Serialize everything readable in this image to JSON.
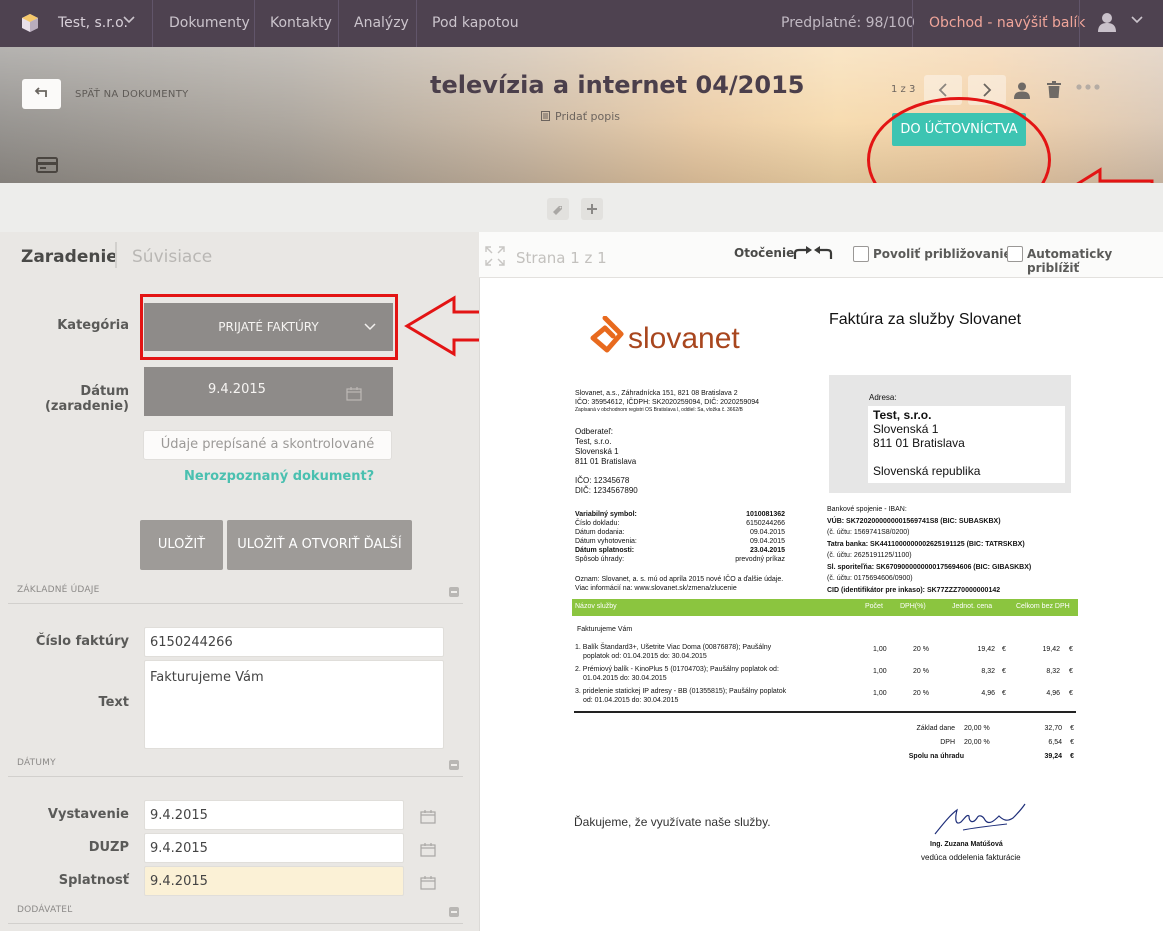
{
  "topnav": {
    "company": "Test, s.r.o.",
    "items": [
      "Dokumenty",
      "Kontakty",
      "Analýzy",
      "Pod kapotou"
    ],
    "subscription": "Predplatné: 98/100",
    "shop": "Obchod - navýšiť balík"
  },
  "header": {
    "back_label": "SPÄŤ NA DOKUMENTY",
    "title": "televízia a internet 04/2015",
    "add_description": "Pridať popis",
    "pager": "1 z 3",
    "accounting_button": "DO ÚČTOVNÍCTVA"
  },
  "left": {
    "tab_active": "Zaradenie",
    "tab_inactive": "Súvisiace",
    "category_label": "Kategória",
    "category_value": "PRIJATÉ FAKTÚRY",
    "date_label": "Dátum (zaradenie)",
    "date_value": "9.4.2015",
    "verified_button": "Údaje prepísané a skontrolované",
    "unrecognized_link": "Nerozpoznaný dokument?",
    "save_button": "ULOŽIŤ",
    "save_next_button": "ULOŽIŤ A OTVORIŤ ĎALŠÍ",
    "section_basic": "ZÁKLADNÉ ÚDAJE",
    "invoice_no_label": "Číslo faktúry",
    "invoice_no_value": "6150244266",
    "text_label": "Text",
    "text_value": "Fakturujeme Vám",
    "section_dates": "DÁTUMY",
    "issued_label": "Vystavenie",
    "issued_value": "9.4.2015",
    "duzp_label": "DUZP",
    "duzp_value": "9.4.2015",
    "due_label": "Splatnosť",
    "due_value": "9.4.2015",
    "section_supplier": "DODÁVATEĽ"
  },
  "viewer": {
    "page_info": "Strana 1 z 1",
    "rotation_label": "Otočenie",
    "allow_zoom": "Povoliť približovanie",
    "auto_zoom": "Automaticky priblížiť"
  },
  "invoice": {
    "logo": "slovanet",
    "title": "Faktúra za služby Slovanet",
    "supplier_lines": [
      "Slovanet, a.s., Záhradnícka 151, 821 08 Bratislava 2",
      "IČO: 35954612, IČDPH: SK2020259094, DIČ: 2020259094",
      "Zapísaná v obchodnom registri OS Bratislava I, oddiel: Sa, vložka č. 3662/B"
    ],
    "customer_lines": [
      "Odberateľ:",
      "Test, s.r.o.",
      "Slovenská 1",
      "811 01 Bratislava"
    ],
    "ids": [
      "IČO: 12345678",
      "DIČ: 1234567890"
    ],
    "address_label": "Adresa:",
    "address_lines": [
      "Test, s.r.o.",
      "Slovenská 1",
      "811 01 Bratislava",
      "",
      "Slovenská republika"
    ],
    "meta": [
      {
        "k": "Variabilný symbol:",
        "v": "1010081362"
      },
      {
        "k": "Číslo dokladu:",
        "v": "6150244266"
      },
      {
        "k": "Dátum dodania:",
        "v": "09.04.2015"
      },
      {
        "k": "Dátum vyhotovenia:",
        "v": "09.04.2015"
      },
      {
        "k": "Dátum splatnosti:",
        "v": "23.04.2015"
      },
      {
        "k": "Spôsob úhrady:",
        "v": "prevodný príkaz"
      }
    ],
    "bank_lines": [
      "Bankové spojenie - IBAN:",
      "VÚB: SK7202000000001569741S8 (BIC: SUBASKBX)",
      "(č. účtu: 1569741S8/0200)",
      "Tatra banka: SK4411000000002625191125 (BIC: TATRSKBX)",
      "(č. účtu: 2625191125/1100)",
      "Sl. sporiteľňa: SK6709000000000175694606 (BIC: GIBASKBX)",
      "(č. účtu: 0175694606/0900)",
      "CID (identifikátor pre inkaso): SK77ZZZ70000000142"
    ],
    "notice": [
      "Oznam: Slovanet, a. s. mú od apríla 2015 nové IČO a ďalšie údaje.",
      "Viac informácií na: www.slovanet.sk/zmena/zlucenie"
    ],
    "columns": [
      "Názov služby",
      "Počet",
      "DPH(%)",
      "Jednot. cena",
      "Celkom bez DPH"
    ],
    "intro": "Fakturujeme Vám",
    "items": [
      {
        "name1": "1. Balík Štandard3+, Ušetrite Viac Doma (00876878); Paušálny",
        "name2": "poplatok od: 01.04.2015 do: 30.04.2015",
        "qty": "1,00",
        "vat": "20 %",
        "unit": "19,42",
        "cur1": "€",
        "total": "19,42",
        "cur2": "€"
      },
      {
        "name1": "2. Prémiový balík - KinoPlus 5 (01704703); Paušálny poplatok od:",
        "name2": "01.04.2015 do: 30.04.2015",
        "qty": "1,00",
        "vat": "20 %",
        "unit": "8,32",
        "cur1": "€",
        "total": "8,32",
        "cur2": "€"
      },
      {
        "name1": "3. pridelenie statickej IP adresy - BB (01355815); Paušálny poplatok",
        "name2": "od: 01.04.2015 do: 30.04.2015",
        "qty": "1,00",
        "vat": "20 %",
        "unit": "4,96",
        "cur1": "€",
        "total": "4,96",
        "cur2": "€"
      }
    ],
    "totals": [
      {
        "k": "Základ dane",
        "p": "20,00 %",
        "v": "32,70",
        "c": "€"
      },
      {
        "k": "DPH",
        "p": "20,00 %",
        "v": "6,54",
        "c": "€"
      },
      {
        "k": "Spolu na úhradu",
        "p": "",
        "v": "39,24",
        "c": "€"
      }
    ],
    "thanks": "Ďakujeme, že využívate naše služby.",
    "signer": "Ing. Zuzana Matúšová",
    "signer_role": "vedúca oddelenia fakturácie"
  }
}
